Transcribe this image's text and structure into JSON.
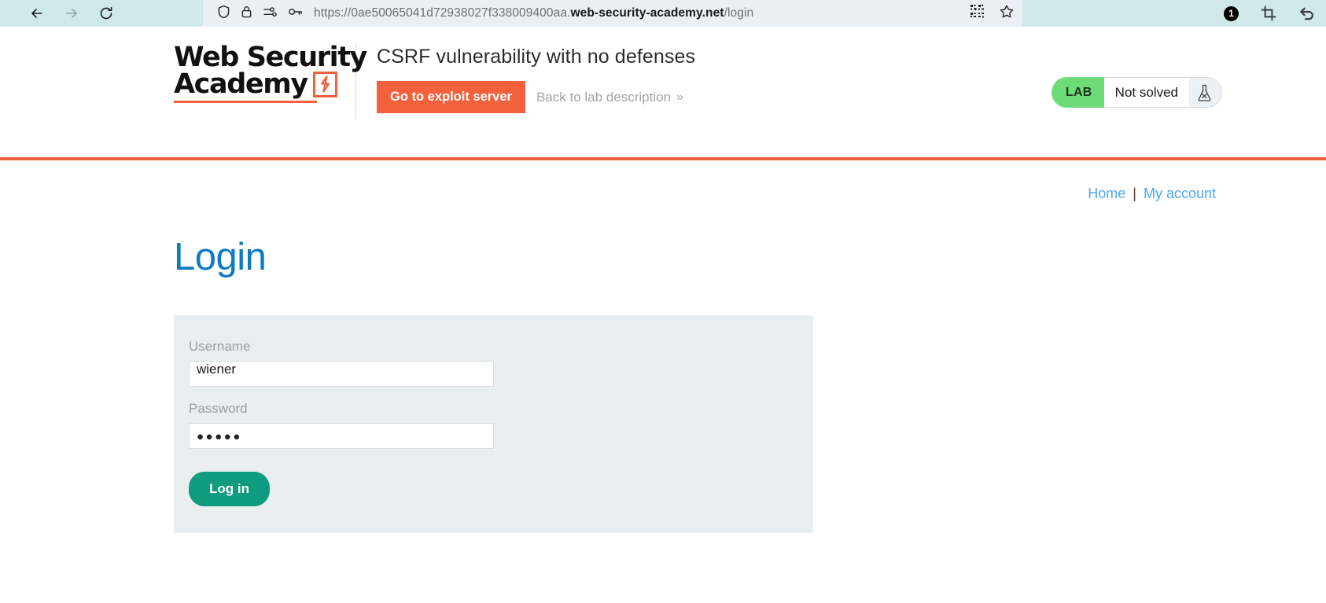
{
  "browser": {
    "back_icon": "back-arrow-icon",
    "forward_icon": "forward-arrow-icon",
    "reload_icon": "reload-icon",
    "shield_icon": "shield-icon",
    "lock_icon": "lock-icon",
    "permissions_icon": "sliders-icon",
    "key_icon": "key-icon",
    "url_scheme": "https://",
    "url_subdomain": "0ae50065041d72938027f338009400aa.",
    "url_host": "web-security-academy.net",
    "url_path": "/login",
    "qr_icon": "qr-code-icon",
    "bookmark_icon": "star-icon",
    "notification_count": "1",
    "screenshot_icon": "crop-icon",
    "undo_icon": "undo-arrow-icon"
  },
  "header": {
    "logo_line1": "Web Security",
    "logo_line2": "Academy",
    "logo_mark": "lightning-bolt-icon",
    "lab_title": "CSRF vulnerability with no defenses",
    "exploit_button": "Go to exploit server",
    "back_link": "Back to lab description",
    "back_link_chevron": "»",
    "accent_color": "#f2603c"
  },
  "lab_status": {
    "tag": "LAB",
    "state": "Not solved",
    "flask_icon": "flask-icon",
    "tag_color": "#6ddb77"
  },
  "account_nav": {
    "home": "Home",
    "separator": "|",
    "my_account": "My account"
  },
  "login": {
    "title": "Login",
    "title_color": "#0d7ac4",
    "username_label": "Username",
    "username_value": "wiener",
    "password_label": "Password",
    "password_value": "●●●●●",
    "password_length": 5,
    "submit_label": "Log in",
    "submit_color": "#0e9b7e",
    "panel_color": "#e9eef1"
  }
}
